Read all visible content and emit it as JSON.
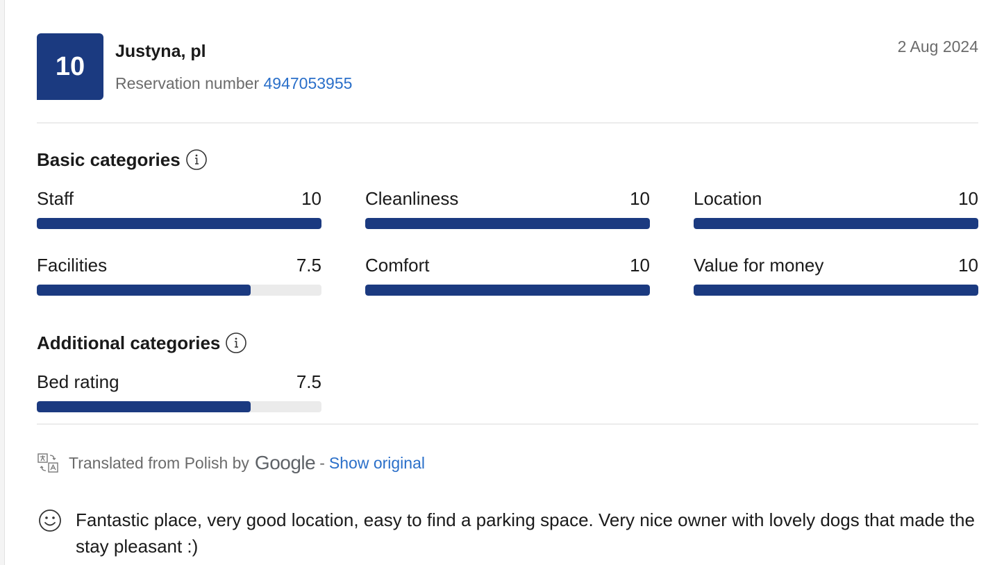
{
  "review": {
    "score": "10",
    "reviewer": "Justyna, pl",
    "reservation_label": "Reservation number",
    "reservation_number": "4947053955",
    "date": "2 Aug 2024"
  },
  "basic": {
    "title": "Basic categories",
    "items": [
      {
        "label": "Staff",
        "value": "10",
        "fraction": 1.0
      },
      {
        "label": "Cleanliness",
        "value": "10",
        "fraction": 1.0
      },
      {
        "label": "Location",
        "value": "10",
        "fraction": 1.0
      },
      {
        "label": "Facilities",
        "value": "7.5",
        "fraction": 0.75
      },
      {
        "label": "Comfort",
        "value": "10",
        "fraction": 1.0
      },
      {
        "label": "Value for money",
        "value": "10",
        "fraction": 1.0
      }
    ]
  },
  "additional": {
    "title": "Additional categories",
    "items": [
      {
        "label": "Bed rating",
        "value": "7.5",
        "fraction": 0.75
      }
    ]
  },
  "translation": {
    "text": "Translated from Polish by",
    "provider": "Google",
    "separator": "-",
    "show_original": "Show original"
  },
  "comment": {
    "text": "Fantastic place, very good location, easy to find a parking space. Very nice owner with lovely dogs that made the stay pleasant :)"
  },
  "colors": {
    "brand": "#1b3a80",
    "link": "#2a6fc9",
    "muted_text": "#6b6b6b",
    "track": "#ebebeb"
  },
  "icons": [
    "info-icon",
    "translate-icon",
    "smile-icon"
  ]
}
